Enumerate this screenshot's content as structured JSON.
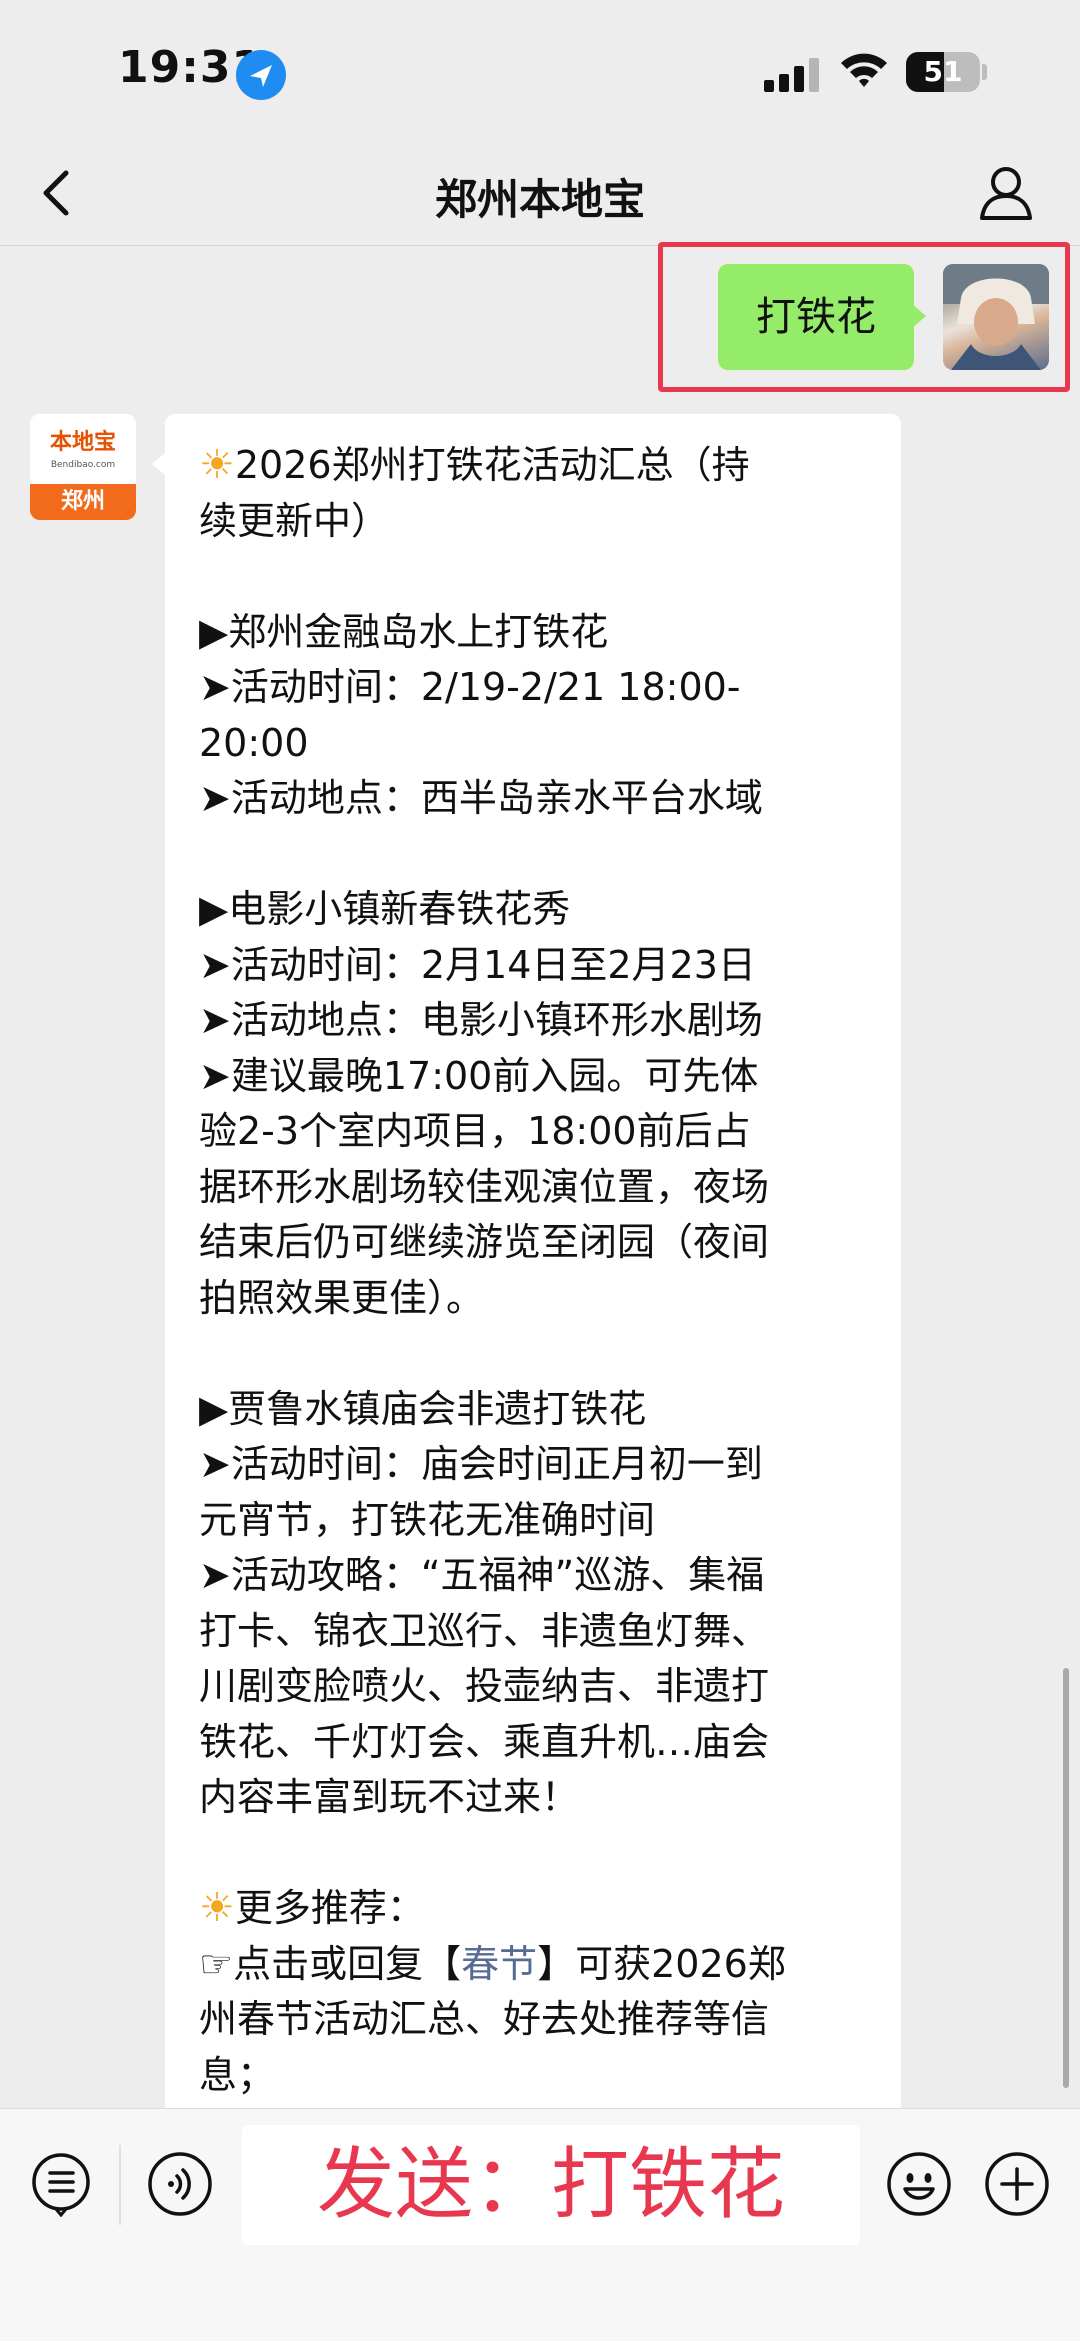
{
  "status_bar": {
    "time": "19:31",
    "battery": "51"
  },
  "nav": {
    "title": "郑州本地宝"
  },
  "sent_message": {
    "text": "打铁花"
  },
  "bot": {
    "avatar_name": "本地宝",
    "avatar_url": "Bendibao.com",
    "avatar_city": "郑州"
  },
  "reply": {
    "lines": [
      {
        "prefix": "",
        "text": "2026郑州打铁花活动汇总（持",
        "sun": true
      },
      {
        "prefix": "",
        "text": "续更新中）"
      },
      {
        "prefix": "",
        "text": ""
      },
      {
        "prefix": "",
        "text": "▶郑州金融岛水上打铁花"
      },
      {
        "prefix": "",
        "text": "➤活动时间：2/19-2/21 18:00-"
      },
      {
        "prefix": "",
        "text": "20:00"
      },
      {
        "prefix": "",
        "text": "➤活动地点：西半岛亲水平台水域"
      },
      {
        "prefix": "",
        "text": ""
      },
      {
        "prefix": "",
        "text": "▶电影小镇新春铁花秀"
      },
      {
        "prefix": "",
        "text": "➤活动时间：2月14日至2月23日"
      },
      {
        "prefix": "",
        "text": "➤活动地点：电影小镇环形水剧场"
      },
      {
        "prefix": "",
        "text": "➤建议最晚17:00前入园。可先体"
      },
      {
        "prefix": "",
        "text": "验2-3个室内项目，18:00前后占"
      },
      {
        "prefix": "",
        "text": "据环形水剧场较佳观演位置，夜场"
      },
      {
        "prefix": "",
        "text": "结束后仍可继续游览至闭园（夜间"
      },
      {
        "prefix": "",
        "text": "拍照效果更佳）。"
      },
      {
        "prefix": "",
        "text": ""
      },
      {
        "prefix": "",
        "text": "▶贾鲁水镇庙会非遗打铁花"
      },
      {
        "prefix": "",
        "text": "➤活动时间：庙会时间正月初一到"
      },
      {
        "prefix": "",
        "text": "元宵节，打铁花无准确时间"
      },
      {
        "prefix": "",
        "text": "➤活动攻略：“五福神”巡游、集福"
      },
      {
        "prefix": "",
        "text": "打卡、锦衣卫巡行、非遗鱼灯舞、"
      },
      {
        "prefix": "",
        "text": "川剧变脸喷火、投壶纳吉、非遗打"
      },
      {
        "prefix": "",
        "text": "铁花、千灯灯会、乘直升机…庙会"
      },
      {
        "prefix": "",
        "text": "内容丰富到玩不过来！"
      },
      {
        "prefix": "",
        "text": ""
      },
      {
        "prefix": "",
        "text": "更多推荐：",
        "sun": true
      },
      {
        "prefix": "☞点击或回复【",
        "link": "春节",
        "suffix": "】可获2026郑"
      },
      {
        "prefix": "",
        "text": "州春节活动汇总、好去处推荐等信"
      },
      {
        "prefix": "",
        "text": "息；"
      }
    ]
  },
  "input": {
    "text": "发送：打铁花"
  },
  "icons": {
    "location": "location-arrow-icon",
    "back": "chevron-left-icon",
    "profile": "person-icon",
    "menu": "list-menu-icon",
    "voice": "voice-icon",
    "emoji": "emoji-icon",
    "plus": "plus-icon"
  },
  "colors": {
    "sent_bubble": "#95ec69",
    "highlight": "#e8384f",
    "link": "#576b95",
    "input_text": "#e8384f"
  }
}
